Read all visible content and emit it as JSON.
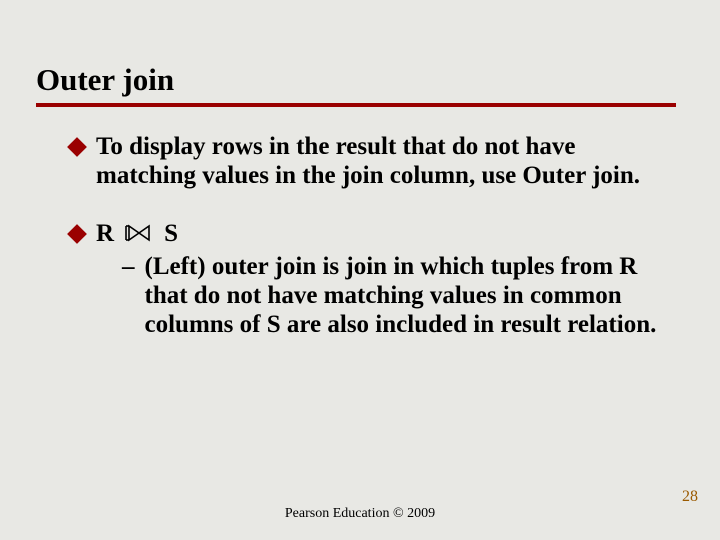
{
  "slide": {
    "title": "Outer join",
    "bullets": [
      {
        "text": "To display rows in the result that do not have matching values in the join column, use Outer join."
      },
      {
        "lhs": "R",
        "symbol_name": "left-outer-join",
        "rhs": "S",
        "sub": {
          "dash": "–",
          "text": "(Left) outer join is join in which tuples from R that do not have matching values in common columns of S are also included in result relation."
        }
      }
    ],
    "footer": "Pearson Education © 2009",
    "page_number": "28"
  },
  "colors": {
    "accent": "#9a0000",
    "pagenum": "#9a5a00",
    "bg": "#e8e8e4"
  }
}
